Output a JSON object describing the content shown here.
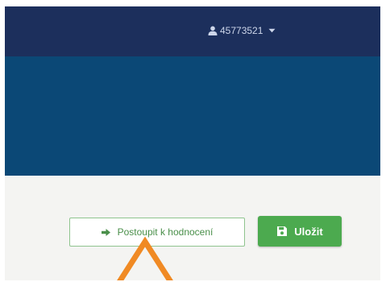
{
  "header": {
    "user_id": "45773521",
    "icons": {
      "user": "user-icon",
      "dropdown": "caret-down-icon"
    }
  },
  "actions": {
    "advance_label": "Postoupit k hodnocení",
    "save_label": "Uložit",
    "icons": {
      "advance": "arrow-right-icon",
      "save": "floppy-disk-icon"
    }
  },
  "colors": {
    "topbar": "#1c2f5c",
    "hero": "#0b4876",
    "content_bg": "#f4f4f2",
    "advance_text": "#4a8f4a",
    "advance_border": "#8fc48f",
    "save_bg": "#4caa4f",
    "annotation": "#f08a24"
  }
}
